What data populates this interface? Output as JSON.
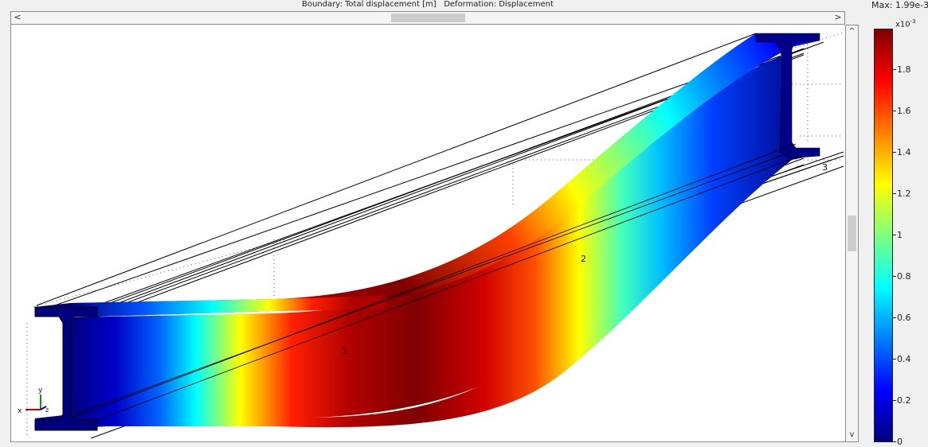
{
  "plot_title": "Boundary: Total displacement [m]   Deformation: Displacement",
  "scrollbars": {
    "left_arrow": "<",
    "right_arrow": ">",
    "up_arrow": "^",
    "down_arrow": "v"
  },
  "colorbar": {
    "max_label": "Max: 1.99e-3",
    "exponent_base": "x10",
    "exponent_power": "-3",
    "ticks": [
      "0",
      "0.2",
      "0.4",
      "0.6",
      "0.8",
      "1",
      "1.2",
      "1.4",
      "1.6",
      "1.8"
    ],
    "colors": [
      "#00007f",
      "#0000ff",
      "#007fff",
      "#00ffff",
      "#7fff7f",
      "#ffff00",
      "#ff7f00",
      "#ff0000",
      "#7f0000"
    ]
  },
  "model": {
    "edge_labels": [
      "1",
      "2",
      "3"
    ],
    "axis_labels": {
      "x": "x",
      "y": "y",
      "z": "z"
    }
  },
  "colors": {
    "background": "#f0f0f0",
    "plot_background": "#ffffff"
  }
}
